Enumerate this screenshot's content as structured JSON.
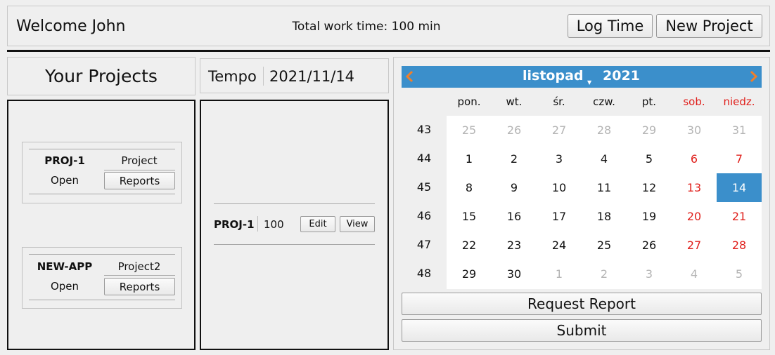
{
  "header": {
    "welcome": "Welcome John",
    "total_work_time": "Total work time: 100 min",
    "log_time_label": "Log Time",
    "new_project_label": "New Project"
  },
  "projects": {
    "title": "Your Projects",
    "items": [
      {
        "key": "PROJ-1",
        "name": "Project",
        "open_label": "Open",
        "reports_label": "Reports"
      },
      {
        "key": "NEW-APP",
        "name": "Project2",
        "open_label": "Open",
        "reports_label": "Reports"
      }
    ]
  },
  "tempo": {
    "label": "Tempo",
    "date": "2021/11/14",
    "entries": [
      {
        "key": "PROJ-1",
        "minutes": "100",
        "edit_label": "Edit",
        "view_label": "View"
      }
    ]
  },
  "calendar": {
    "month": "listopad",
    "year": "2021",
    "day_headers": [
      "pon.",
      "wt.",
      "śr.",
      "czw.",
      "pt.",
      "sob.",
      "niedz."
    ],
    "weeks": [
      {
        "week": "43",
        "days": [
          {
            "d": "25",
            "other": true
          },
          {
            "d": "26",
            "other": true
          },
          {
            "d": "27",
            "other": true
          },
          {
            "d": "28",
            "other": true
          },
          {
            "d": "29",
            "other": true
          },
          {
            "d": "30",
            "other": true
          },
          {
            "d": "31",
            "other": true
          }
        ]
      },
      {
        "week": "44",
        "days": [
          {
            "d": "1"
          },
          {
            "d": "2"
          },
          {
            "d": "3"
          },
          {
            "d": "4"
          },
          {
            "d": "5"
          },
          {
            "d": "6"
          },
          {
            "d": "7"
          }
        ]
      },
      {
        "week": "45",
        "days": [
          {
            "d": "8"
          },
          {
            "d": "9"
          },
          {
            "d": "10"
          },
          {
            "d": "11"
          },
          {
            "d": "12"
          },
          {
            "d": "13"
          },
          {
            "d": "14",
            "selected": true
          }
        ]
      },
      {
        "week": "46",
        "days": [
          {
            "d": "15"
          },
          {
            "d": "16"
          },
          {
            "d": "17"
          },
          {
            "d": "18"
          },
          {
            "d": "19"
          },
          {
            "d": "20"
          },
          {
            "d": "21"
          }
        ]
      },
      {
        "week": "47",
        "days": [
          {
            "d": "22"
          },
          {
            "d": "23"
          },
          {
            "d": "24"
          },
          {
            "d": "25"
          },
          {
            "d": "26"
          },
          {
            "d": "27"
          },
          {
            "d": "28"
          }
        ]
      },
      {
        "week": "48",
        "days": [
          {
            "d": "29"
          },
          {
            "d": "30"
          },
          {
            "d": "1",
            "other": true
          },
          {
            "d": "2",
            "other": true
          },
          {
            "d": "3",
            "other": true
          },
          {
            "d": "4",
            "other": true
          },
          {
            "d": "5",
            "other": true
          }
        ]
      }
    ],
    "colors": {
      "accent": "#3b8fcb",
      "weekend": "#e0201c",
      "other_month": "#b4b4b4",
      "nav_arrow": "#f07f2a"
    },
    "prev_icon": "chevron-left-icon",
    "next_icon": "chevron-right-icon",
    "dropdown_icon": "dropdown-arrow-icon"
  },
  "actions": {
    "request_report_label": "Request Report",
    "submit_label": "Submit"
  }
}
